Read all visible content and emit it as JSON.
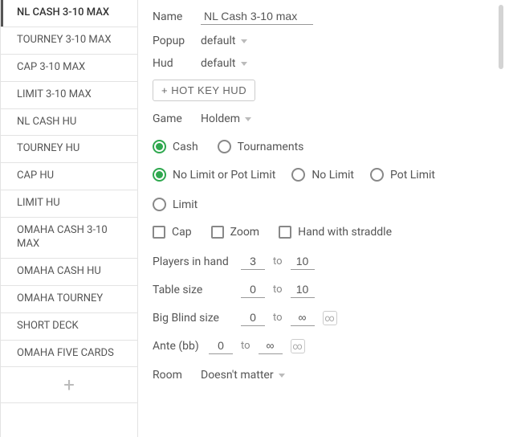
{
  "sidebar": {
    "items": [
      {
        "label": "NL CASH 3-10 MAX",
        "selected": true
      },
      {
        "label": "TOURNEY 3-10 MAX"
      },
      {
        "label": "CAP 3-10 MAX"
      },
      {
        "label": "LIMIT 3-10 MAX"
      },
      {
        "label": "NL CASH HU"
      },
      {
        "label": "TOURNEY HU"
      },
      {
        "label": "CAP HU"
      },
      {
        "label": "LIMIT HU"
      },
      {
        "label": "OMAHA CASH 3-10 MAX"
      },
      {
        "label": "OMAHA CASH HU"
      },
      {
        "label": "OMAHA TOURNEY"
      },
      {
        "label": "SHORT DECK"
      },
      {
        "label": "OMAHA FIVE CARDS"
      }
    ],
    "add_label": "+"
  },
  "form": {
    "name_label": "Name",
    "name_value": "NL Cash 3-10 max",
    "popup_label": "Popup",
    "popup_value": "default",
    "hud_label": "Hud",
    "hud_value": "default",
    "hotkey_label": "+ HOT KEY HUD",
    "game_label": "Game",
    "game_value": "Holdem",
    "type_radio": {
      "cash": "Cash",
      "tournaments": "Tournaments"
    },
    "limit_radio": {
      "nl_or_pl": "No Limit or Pot Limit",
      "nl": "No Limit",
      "pl": "Pot Limit",
      "limit": "Limit"
    },
    "checks": {
      "cap": "Cap",
      "zoom": "Zoom",
      "straddle": "Hand with straddle"
    },
    "players_label": "Players in hand",
    "players_from": "3",
    "players_to": "10",
    "table_label": "Table size",
    "table_from": "0",
    "table_to": "10",
    "bb_label": "Big Blind size",
    "bb_from": "0",
    "bb_to": "∞",
    "ante_label": "Ante (bb)",
    "ante_from": "0",
    "ante_to": "∞",
    "to_word": "to",
    "inf_glyph": "∞",
    "room_label": "Room",
    "room_value": "Doesn't matter"
  }
}
